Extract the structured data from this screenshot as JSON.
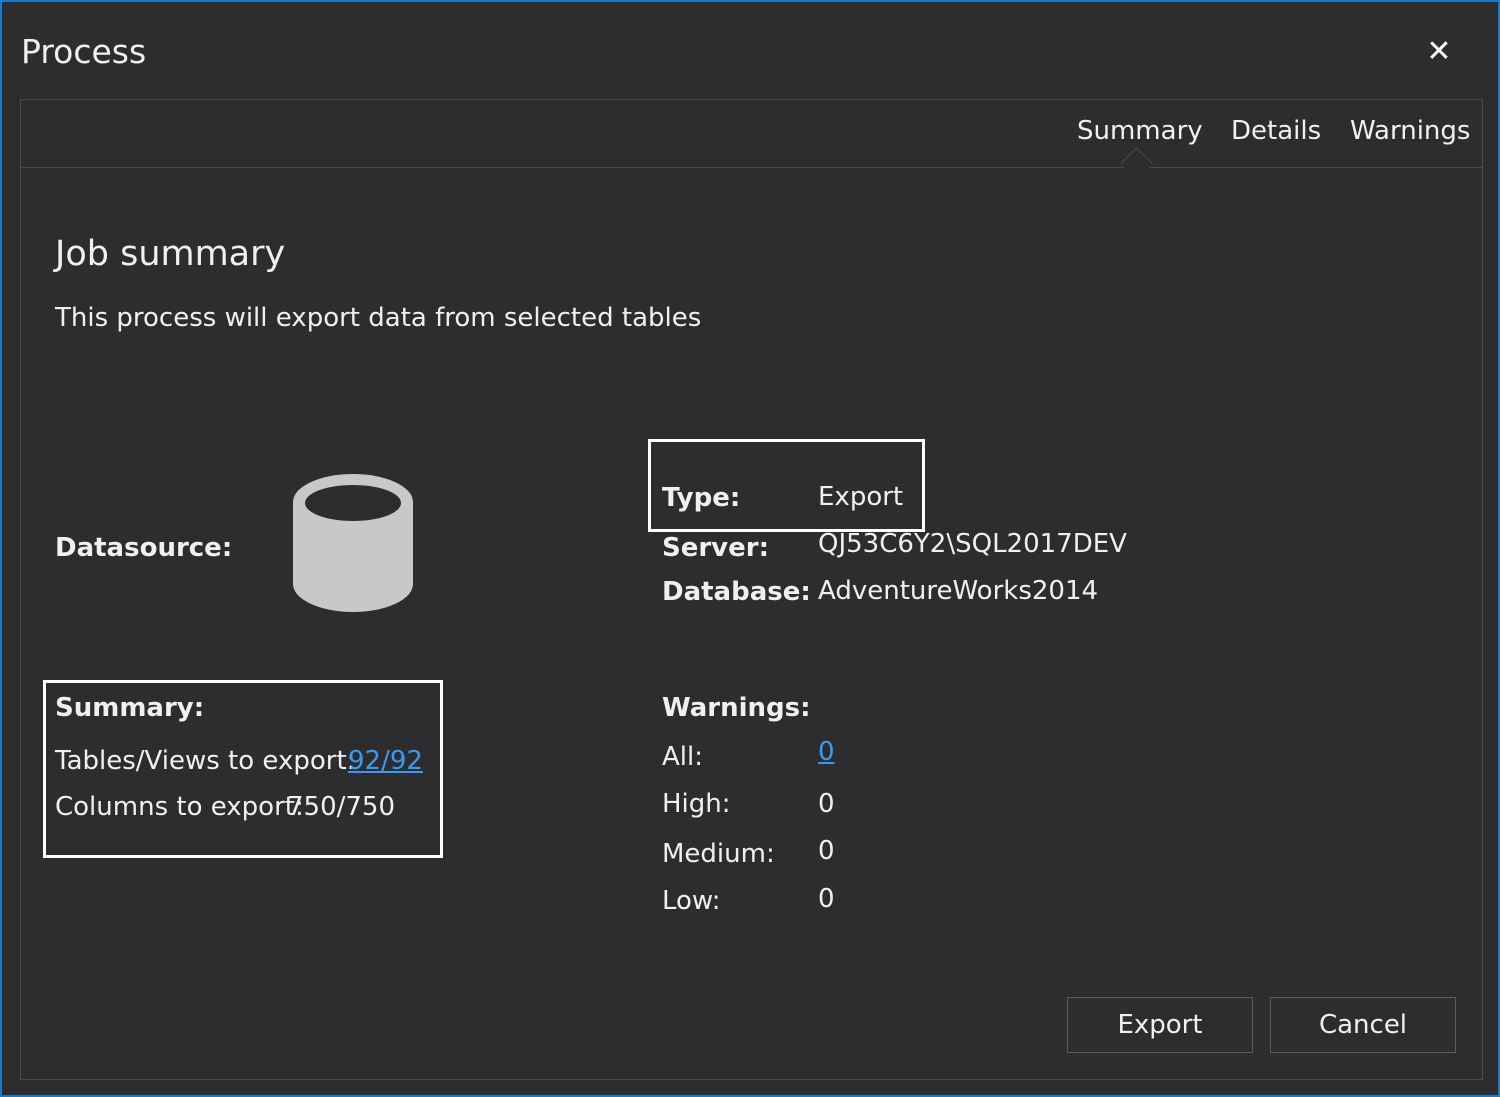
{
  "window": {
    "title": "Process",
    "close_icon": "close-icon"
  },
  "tabs": [
    {
      "label": "Summary",
      "active": true
    },
    {
      "label": "Details",
      "active": false
    },
    {
      "label": "Warnings",
      "active": false
    }
  ],
  "job": {
    "heading": "Job summary",
    "description": "This process will export data from selected tables"
  },
  "datasource": {
    "label": "Datasource:",
    "icon": "database-icon",
    "type_label": "Type:",
    "type_value": "Export",
    "server_label": "Server:",
    "server_value": "QJ53C6Y2\\SQL2017DEV",
    "database_label": "Database:",
    "database_value": "AdventureWorks2014"
  },
  "summary": {
    "label": "Summary:",
    "tables_label": "Tables/Views to export:",
    "tables_value": "92/92",
    "columns_label": "Columns to export:",
    "columns_value": "750/750"
  },
  "warnings": {
    "label": "Warnings:",
    "all_label": "All:",
    "all_value": "0",
    "high_label": "High:",
    "high_value": "0",
    "medium_label": "Medium:",
    "medium_value": "0",
    "low_label": "Low:",
    "low_value": "0"
  },
  "buttons": {
    "export": "Export",
    "cancel": "Cancel"
  },
  "colors": {
    "window_border": "#1c79c2",
    "background": "#2d2d30",
    "link": "#3a9af0",
    "highlight_box": "#ffffff"
  }
}
